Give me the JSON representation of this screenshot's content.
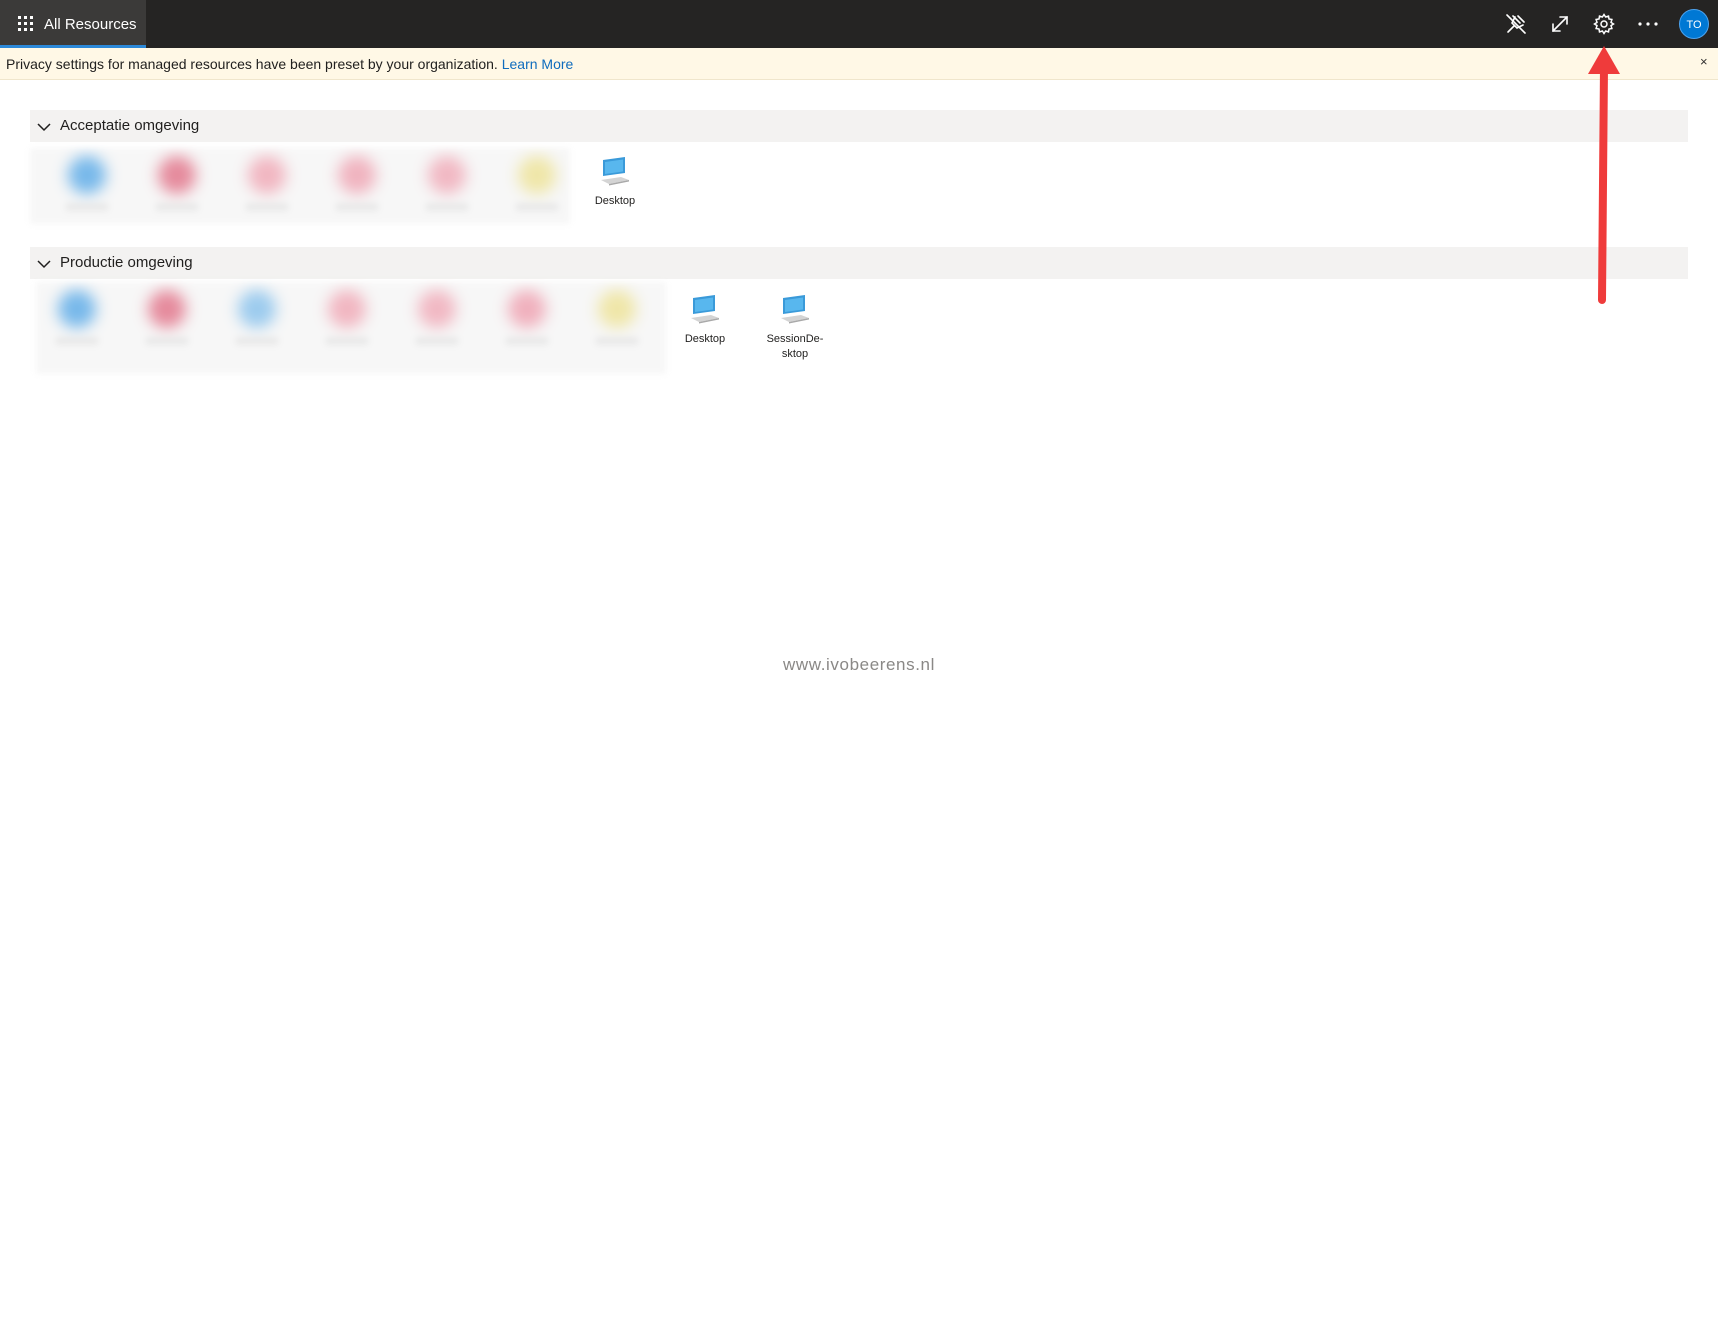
{
  "topbar": {
    "title": "All Resources",
    "icons": [
      "unpin-icon",
      "fullscreen-icon",
      "settings-gear-icon",
      "more-options-icon"
    ],
    "avatar_initials": "TO",
    "colors": {
      "bar": "#252423",
      "active_tab": "#3b3a39",
      "tab_underline": "#2b88d8",
      "avatar": "#0078d4"
    }
  },
  "banner": {
    "message": "Privacy settings for managed resources have been preset by your organization.",
    "link": "Learn More",
    "close": "×",
    "background": "#fff8e6"
  },
  "groups": [
    {
      "title": "Acceptatie omgeving",
      "resources": [
        {
          "label": "Desktop",
          "icon": "remote-desktop-icon"
        }
      ]
    },
    {
      "title": "Productie omgeving",
      "resources": [
        {
          "label": "Desktop",
          "icon": "remote-desktop-icon"
        },
        {
          "label": "SessionDe-\nsktop",
          "icon": "remote-desktop-icon"
        }
      ]
    }
  ],
  "watermark": "www.ivobeerens.nl",
  "annotation": {
    "type": "arrow",
    "points_to": "settings-gear-icon",
    "color": "#ef3b3b"
  }
}
